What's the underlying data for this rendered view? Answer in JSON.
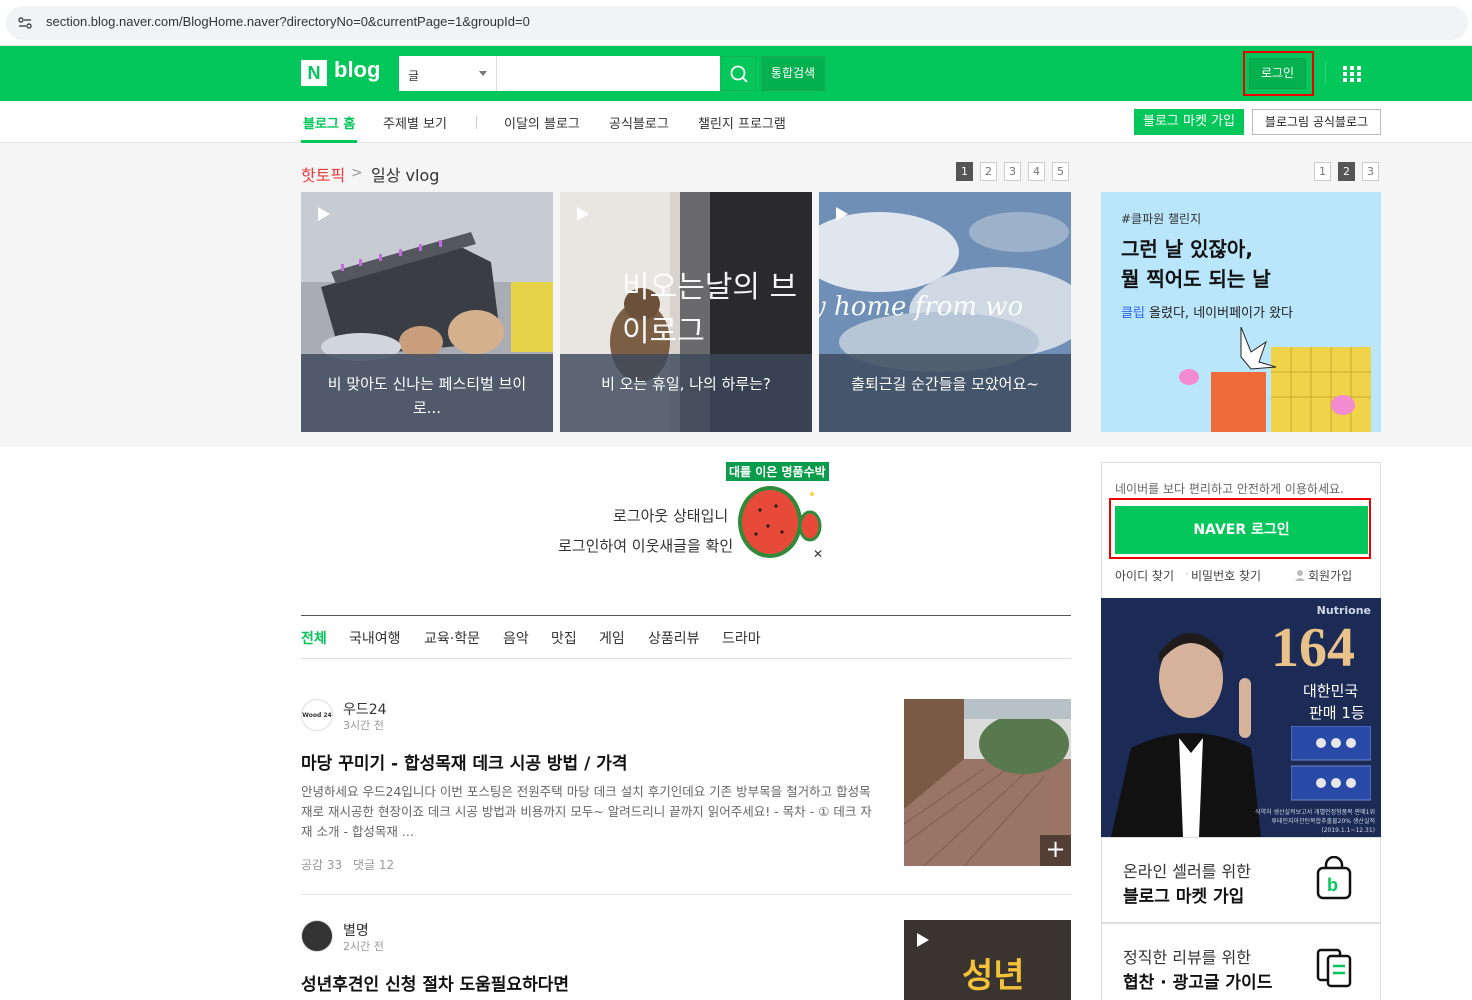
{
  "browser": {
    "url": "section.blog.naver.com/BlogHome.naver?directoryNo=0&currentPage=1&groupId=0"
  },
  "header": {
    "logo_n": "N",
    "logo_text": "blog",
    "search_scope": "글",
    "search_placeholder": "",
    "integrated_search_label": "통합검색",
    "login_label": "로그인"
  },
  "subnav": {
    "items": [
      "블로그 홈",
      "주제별 보기",
      "이달의 블로그",
      "공식블로그",
      "챌린지 프로그램"
    ],
    "market_join": "블로그 마켓 가입",
    "blogrim_official": "블로그림 공식블로그"
  },
  "hot_topic": {
    "label": "핫토픽",
    "topic": "일상 vlog",
    "pages": [
      "1",
      "2",
      "3",
      "4",
      "5"
    ],
    "active_page": "1",
    "cards": [
      {
        "title": "비 맞아도 신나는 페스티벌 브이로..."
      },
      {
        "title": "비 오는 휴일, 나의 하루는?",
        "caption": "비오는날의 브이로그"
      },
      {
        "title": "출퇴근길 순간들을 모았어요~",
        "caption": "y home from wo"
      }
    ]
  },
  "ad_banner": {
    "pages": [
      "1",
      "2",
      "3"
    ],
    "active_page": "2",
    "tag": "#클파원 챌린지",
    "headline1": "그런 날 있잖아,",
    "headline2": "뭘 찍어도 되는 날",
    "body_brand": "클립",
    "body_rest": " 올렸다, 네이버페이가 왔다"
  },
  "logged_out": {
    "line1": "로그아웃 상태입니",
    "line2": "로그인하여 이웃새글을 확인",
    "watermelon_ad": "대를 이은 명품수박"
  },
  "categories": [
    "전체",
    "국내여행",
    "교육·학문",
    "음악",
    "맛집",
    "게임",
    "상품리뷰",
    "드라마"
  ],
  "posts": [
    {
      "author": "우드24",
      "avatar_text": "Wood 24",
      "time": "3시간 전",
      "title": "마당 꾸미기 - 합성목재 데크 시공 방법 / 가격",
      "desc": "안녕하세요 우드24입니다 이번 포스팅은 전원주택 마당 데크 설치 후기인데요 기존 방부목을 철거하고 합성목재로 재시공한 현장이죠 데크 시공 방법과 비용까지 모두~ 알려드리니 끝까지 읽어주세요! - 목차 - ① 데크 자재 소개 - 합성목재 ...",
      "likes": "공감 33",
      "comments": "댓글 12",
      "plus": "+"
    },
    {
      "author": "별명",
      "time": "2시간 전",
      "title": "성년후견인 신청 절차 도움필요하다면",
      "thumb_text": "성년"
    }
  ],
  "login_box": {
    "message": "네이버를 보다 편리하고 안전하게 이용하세요.",
    "naver_login": "NAVER 로그인",
    "find_id": "아이디 찾기",
    "find_pw": "비밀번호 찾기",
    "signup": "회원가입"
  },
  "side_ad": {
    "brand": "Nutrione",
    "number": "164",
    "line1": "대한민국",
    "line2": "판매 1등",
    "fine1": "식약처 생산실적보고서 개별인정형품목 판매1위",
    "fine2": "루테인지아잔틴복합추출물20% 생산실적 (2019.1.1~12.31)"
  },
  "promos": [
    {
      "line1": "온라인 셀러를 위한",
      "line2": "블로그 마켓 가입"
    },
    {
      "line1": "정직한 리뷰를 위한",
      "line2": "협찬 · 광고글 가이드"
    }
  ],
  "colors": {
    "naver_green": "#03c75a",
    "hot_red": "#ea3a3a",
    "highlight": "#e00000"
  }
}
